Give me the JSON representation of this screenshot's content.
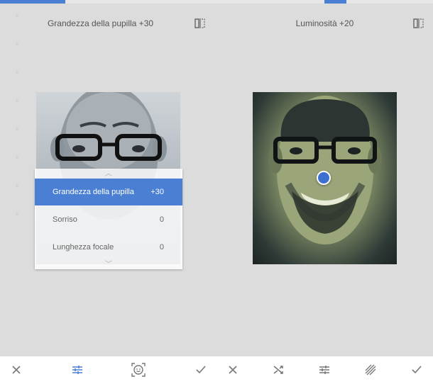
{
  "left": {
    "progress": 0.3,
    "title": "Grandezza della pupilla +30",
    "dropdown": {
      "items": [
        {
          "label": "Grandezza della pupilla",
          "value": "+30",
          "active": true
        },
        {
          "label": "Sorriso",
          "value": "0",
          "active": false
        },
        {
          "label": "Lunghezza focale",
          "value": "0",
          "active": false
        }
      ]
    },
    "toolbar": [
      "close-icon",
      "sliders-icon",
      "face-icon",
      "check-icon"
    ]
  },
  "right": {
    "progress": 0.1,
    "title": "Luminosità +20",
    "toolbar": [
      "close-icon",
      "shuffle-icon",
      "sliders-icon",
      "texture-icon",
      "check-icon"
    ]
  },
  "colors": {
    "accent": "#4a7fd4",
    "background": "#dcdcdc",
    "icon": "#777777"
  }
}
